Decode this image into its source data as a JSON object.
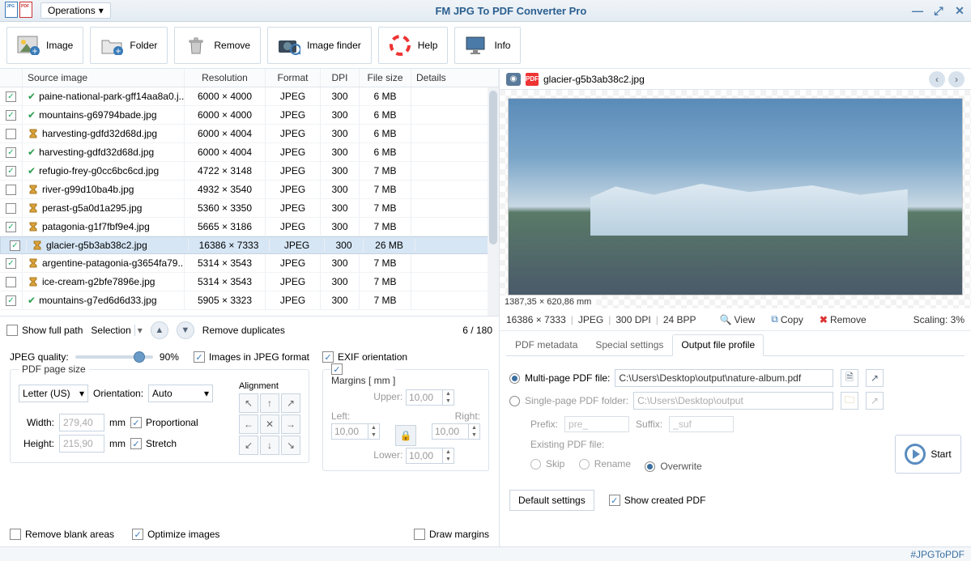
{
  "titlebar": {
    "operations": "Operations",
    "title": "FM JPG To PDF Converter Pro"
  },
  "toolbar": {
    "image": "Image",
    "folder": "Folder",
    "remove": "Remove",
    "imagefinder": "Image finder",
    "help": "Help",
    "info": "Info"
  },
  "grid": {
    "head": {
      "c1": "Source image",
      "c2": "Resolution",
      "c3": "Format",
      "c4": "DPI",
      "c5": "File size",
      "c6": "Details"
    },
    "rows": [
      {
        "checked": true,
        "ready": true,
        "name": "paine-national-park-gff14aa8a0.j...",
        "res": "6000 × 4000",
        "fmt": "JPEG",
        "dpi": "300",
        "size": "6 MB",
        "sel": false
      },
      {
        "checked": true,
        "ready": true,
        "name": "mountains-g69794bade.jpg",
        "res": "6000 × 4000",
        "fmt": "JPEG",
        "dpi": "300",
        "size": "6 MB",
        "sel": false
      },
      {
        "checked": false,
        "ready": false,
        "name": "harvesting-gdfd32d68d.jpg",
        "res": "6000 × 4004",
        "fmt": "JPEG",
        "dpi": "300",
        "size": "6 MB",
        "sel": false
      },
      {
        "checked": true,
        "ready": true,
        "name": "harvesting-gdfd32d68d.jpg",
        "res": "6000 × 4004",
        "fmt": "JPEG",
        "dpi": "300",
        "size": "6 MB",
        "sel": false
      },
      {
        "checked": true,
        "ready": true,
        "name": "refugio-frey-g0cc6bc6cd.jpg",
        "res": "4722 × 3148",
        "fmt": "JPEG",
        "dpi": "300",
        "size": "7 MB",
        "sel": false
      },
      {
        "checked": false,
        "ready": false,
        "name": "river-g99d10ba4b.jpg",
        "res": "4932 × 3540",
        "fmt": "JPEG",
        "dpi": "300",
        "size": "7 MB",
        "sel": false
      },
      {
        "checked": false,
        "ready": false,
        "name": "perast-g5a0d1a295.jpg",
        "res": "5360 × 3350",
        "fmt": "JPEG",
        "dpi": "300",
        "size": "7 MB",
        "sel": false
      },
      {
        "checked": true,
        "ready": false,
        "name": "patagonia-g1f7fbf9e4.jpg",
        "res": "5665 × 3186",
        "fmt": "JPEG",
        "dpi": "300",
        "size": "7 MB",
        "sel": false
      },
      {
        "checked": true,
        "ready": false,
        "name": "glacier-g5b3ab38c2.jpg",
        "res": "16386 × 7333",
        "fmt": "JPEG",
        "dpi": "300",
        "size": "26 MB",
        "sel": true
      },
      {
        "checked": true,
        "ready": false,
        "name": "argentine-patagonia-g3654fa79...",
        "res": "5314 × 3543",
        "fmt": "JPEG",
        "dpi": "300",
        "size": "7 MB",
        "sel": false
      },
      {
        "checked": false,
        "ready": false,
        "name": "ice-cream-g2bfe7896e.jpg",
        "res": "5314 × 3543",
        "fmt": "JPEG",
        "dpi": "300",
        "size": "7 MB",
        "sel": false
      },
      {
        "checked": true,
        "ready": true,
        "name": "mountains-g7ed6d6d33.jpg",
        "res": "5905 × 3323",
        "fmt": "JPEG",
        "dpi": "300",
        "size": "7 MB",
        "sel": false
      }
    ]
  },
  "fileops": {
    "showfull": "Show full path",
    "selection": "Selection",
    "removedup": "Remove duplicates",
    "counter": "6 / 180"
  },
  "settings": {
    "jpegq_label": "JPEG quality:",
    "jpegq_val": "90%",
    "imgjpeg": "Images in JPEG format",
    "exif": "EXIF orientation",
    "pagesize": {
      "title": "PDF page size",
      "size": "Letter (US)",
      "orient_label": "Orientation:",
      "orient": "Auto",
      "width_label": "Width:",
      "width": "279,40",
      "height_label": "Height:",
      "height": "215,90",
      "unit": "mm",
      "prop": "Proportional",
      "stretch": "Stretch",
      "align": "Alignment"
    },
    "margins": {
      "title": "Margins [ mm ]",
      "upper_l": "Upper:",
      "left_l": "Left:",
      "right_l": "Right:",
      "lower_l": "Lower:",
      "val": "10,00"
    },
    "removeblank": "Remove blank areas",
    "optimize": "Optimize images",
    "drawmargins": "Draw margins"
  },
  "preview": {
    "filename": "glacier-g5b3ab38c2.jpg",
    "sizemm": "1387,35 × 620,86 mm",
    "info": {
      "res": "16386 × 7333",
      "fmt": "JPEG",
      "dpi": "300 DPI",
      "bpp": "24 BPP"
    },
    "view": "View",
    "copy": "Copy",
    "remove": "Remove",
    "scaling": "Scaling: 3%"
  },
  "tabs": {
    "meta": "PDF metadata",
    "special": "Special settings",
    "profile": "Output file profile"
  },
  "profile": {
    "multi": "Multi-page PDF file:",
    "multi_path": "C:\\Users\\Desktop\\output\\nature-album.pdf",
    "single": "Single-page PDF folder:",
    "single_path": "C:\\Users\\Desktop\\output",
    "prefix_l": "Prefix:",
    "prefix": "pre_",
    "suffix_l": "Suffix:",
    "suffix": "_suf",
    "existing_l": "Existing PDF file:",
    "skip": "Skip",
    "rename": "Rename",
    "overwrite": "Overwrite",
    "start": "Start",
    "defaults": "Default settings",
    "showpdf": "Show created PDF"
  },
  "status": {
    "hashtag": "#JPGToPDF"
  }
}
